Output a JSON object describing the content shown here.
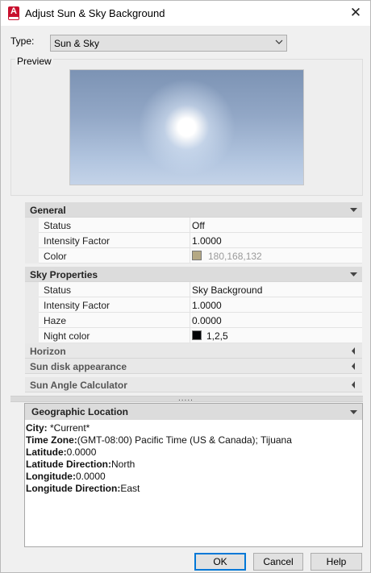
{
  "window": {
    "title": "Adjust Sun & Sky Background",
    "close_glyph": "✕",
    "icon_letter": "A"
  },
  "type": {
    "label": "Type:",
    "value": "Sun & Sky"
  },
  "preview": {
    "label": "Preview"
  },
  "general": {
    "title": "General",
    "rows": [
      {
        "key": "Status",
        "value": "Off"
      },
      {
        "key": "Intensity Factor",
        "value": "1.0000"
      },
      {
        "key": "Color",
        "value": "180,168,132",
        "swatch": "#b4a884"
      }
    ]
  },
  "sky": {
    "title": "Sky Properties",
    "rows": [
      {
        "key": "Status",
        "value": "Sky Background"
      },
      {
        "key": "Intensity Factor",
        "value": "1.0000"
      },
      {
        "key": "Haze",
        "value": "0.0000"
      },
      {
        "key": "Night color",
        "value": "1,2,5",
        "swatch": "#010205"
      }
    ]
  },
  "collapsed": [
    {
      "title": "Horizon"
    },
    {
      "title": "Sun disk appearance"
    },
    {
      "title": "Sun Angle Calculator"
    }
  ],
  "splitter": {
    "grip": "....."
  },
  "geo": {
    "title": "Geographic Location",
    "lines": [
      {
        "key": "City: ",
        "value": "*Current*"
      },
      {
        "key": "Time Zone:",
        "value": "(GMT-08:00) Pacific Time (US & Canada); Tijuana"
      },
      {
        "key": "Latitude:",
        "value": "0.0000"
      },
      {
        "key": "Latitude Direction:",
        "value": "North"
      },
      {
        "key": "Longitude:",
        "value": "0.0000"
      },
      {
        "key": "Longitude Direction:",
        "value": "East"
      }
    ]
  },
  "buttons": {
    "ok": "OK",
    "cancel": "Cancel",
    "help": "Help"
  },
  "colors": {
    "accent": "#0078d7",
    "app_icon": "#c8102e"
  }
}
